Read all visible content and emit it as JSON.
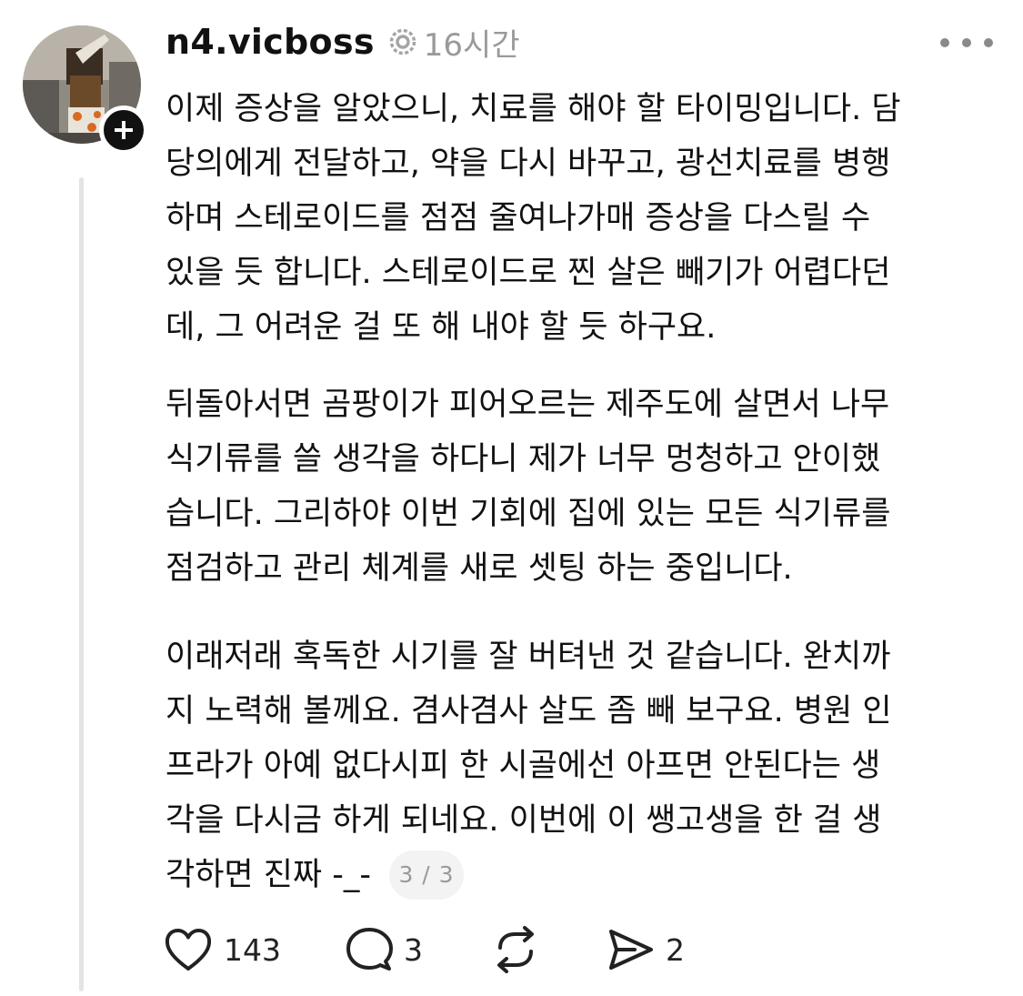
{
  "post": {
    "username": "n4.vicboss",
    "time": "16시간",
    "paragraphs": [
      [
        "이제 증상을 알았으니, 치료를 해야 할 타이밍입니다. 담",
        "당의에게 전달하고, 약을 다시 바꾸고, 광선치료를 병행",
        "하며 스테로이드를 점점 줄여나가매 증상을 다스릴 수",
        "있을 듯 합니다. 스테로이드로 찐 살은 빼기가 어렵다던",
        "데, 그 어려운 걸 또 해 내야 할 듯 하구요."
      ],
      [
        "뒤돌아서면 곰팡이가 피어오르는 제주도에 살면서 나무",
        "식기류를 쓸 생각을 하다니 제가 너무 멍청하고 안이했",
        "습니다. 그리하야 이번 기회에 집에 있는 모든 식기류를",
        "점검하고 관리 체계를 새로 셋팅 하는 중입니다."
      ],
      [
        "이래저래 혹독한 시기를 잘 버텨낸 것 같습니다. 완치까",
        "지 노력해 볼께요. 겸사겸사 살도 좀 빼 보구요. 병원 인",
        "프라가 아예 없다시피 한 시골에선 아프면 안된다는 생",
        "각을 다시금 하게 되네요. 이번에 이 쌩고생을 한 걸 생"
      ]
    ],
    "last_line": "각하면 진짜 -_-",
    "page_indicator": "3 / 3"
  },
  "actions": {
    "likes": "143",
    "comments": "3",
    "shares": "2"
  },
  "icons": [
    "threads-icon",
    "more-icon",
    "heart-icon",
    "comment-icon",
    "repost-icon",
    "share-icon",
    "plus-icon"
  ]
}
